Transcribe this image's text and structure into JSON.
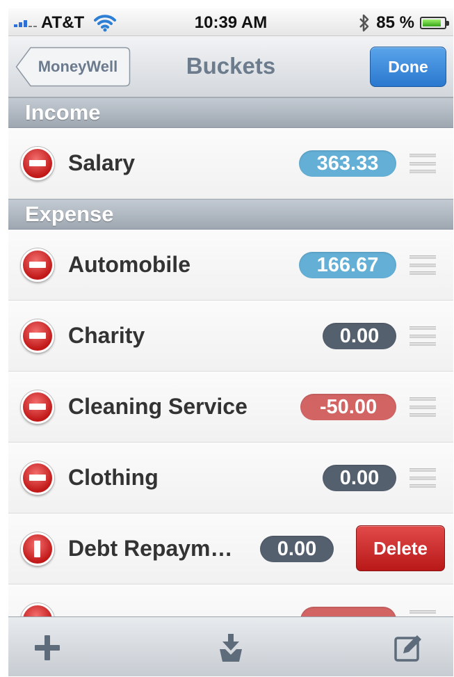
{
  "status_bar": {
    "carrier": "AT&T",
    "time": "10:39 AM",
    "battery_percent": "85 %",
    "battery_level": 0.85
  },
  "nav": {
    "back_label": "MoneyWell",
    "title": "Buckets",
    "done_label": "Done"
  },
  "sections": {
    "income": {
      "title": "Income",
      "rows": [
        {
          "label": "Salary",
          "amount": "363.33",
          "badge_color": "#63afd6"
        }
      ]
    },
    "expense": {
      "title": "Expense",
      "rows": [
        {
          "label": "Automobile",
          "amount": "166.67",
          "badge_color": "#63afd6"
        },
        {
          "label": "Charity",
          "amount": "0.00",
          "badge_color": "#55606e"
        },
        {
          "label": "Cleaning Service",
          "amount": "-50.00",
          "badge_color": "#d26464"
        },
        {
          "label": "Clothing",
          "amount": "0.00",
          "badge_color": "#55606e"
        },
        {
          "label": "Debt Repaym…",
          "amount": "0.00",
          "badge_color": "#55606e",
          "delete_label": "Delete"
        }
      ]
    }
  },
  "toolbar": {
    "add_icon": "plus-icon",
    "import_icon": "download-tray-icon",
    "edit_icon": "compose-icon"
  },
  "colors": {
    "accent": "#2a78cf",
    "positive": "#63afd6",
    "zero": "#55606e",
    "negative": "#d26464",
    "delete": "#b81818"
  }
}
